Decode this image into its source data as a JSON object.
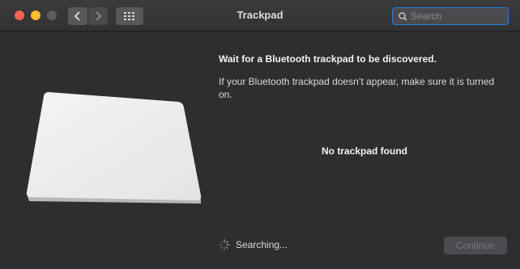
{
  "window": {
    "title": "Trackpad"
  },
  "toolbar": {
    "back_icon": "chevron-left-icon",
    "forward_icon": "chevron-right-icon",
    "grid_icon": "show-all-grid-icon"
  },
  "search": {
    "placeholder": "Search",
    "value": ""
  },
  "content": {
    "heading": "Wait for a Bluetooth trackpad to be discovered.",
    "description": "If your Bluetooth trackpad doesn’t appear, make sure it is turned on.",
    "status": "No trackpad found",
    "searching_label": "Searching...",
    "continue_label": "Continue"
  },
  "colors": {
    "close": "#fe5f57",
    "minimize": "#febc2e",
    "accent": "#2b7cd8"
  }
}
